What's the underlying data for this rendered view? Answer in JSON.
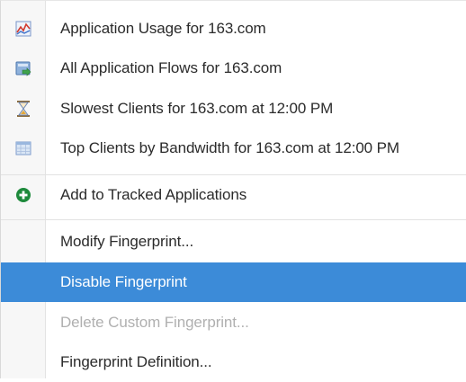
{
  "menu": {
    "items": [
      {
        "label": "Application Usage for 163.com",
        "icon": "app-usage-chart-icon"
      },
      {
        "label": "All Application Flows for 163.com",
        "icon": "app-flows-icon"
      },
      {
        "label": "Slowest Clients for 163.com at 12:00 PM",
        "icon": "hourglass-icon"
      },
      {
        "label": "Top Clients by Bandwidth for 163.com at 12:00 PM",
        "icon": "table-icon"
      },
      {
        "label": "Add to Tracked Applications",
        "icon": "add-circle-icon"
      },
      {
        "label": "Modify Fingerprint...",
        "icon": ""
      },
      {
        "label": "Disable Fingerprint",
        "icon": "",
        "selected": true
      },
      {
        "label": "Delete Custom Fingerprint...",
        "icon": "",
        "disabled": true
      },
      {
        "label": "Fingerprint Definition...",
        "icon": ""
      }
    ],
    "colors": {
      "selected_bg": "#3c8bd8",
      "disabled_text": "#b0b0b0",
      "add_icon": "#1e8a3c"
    }
  }
}
